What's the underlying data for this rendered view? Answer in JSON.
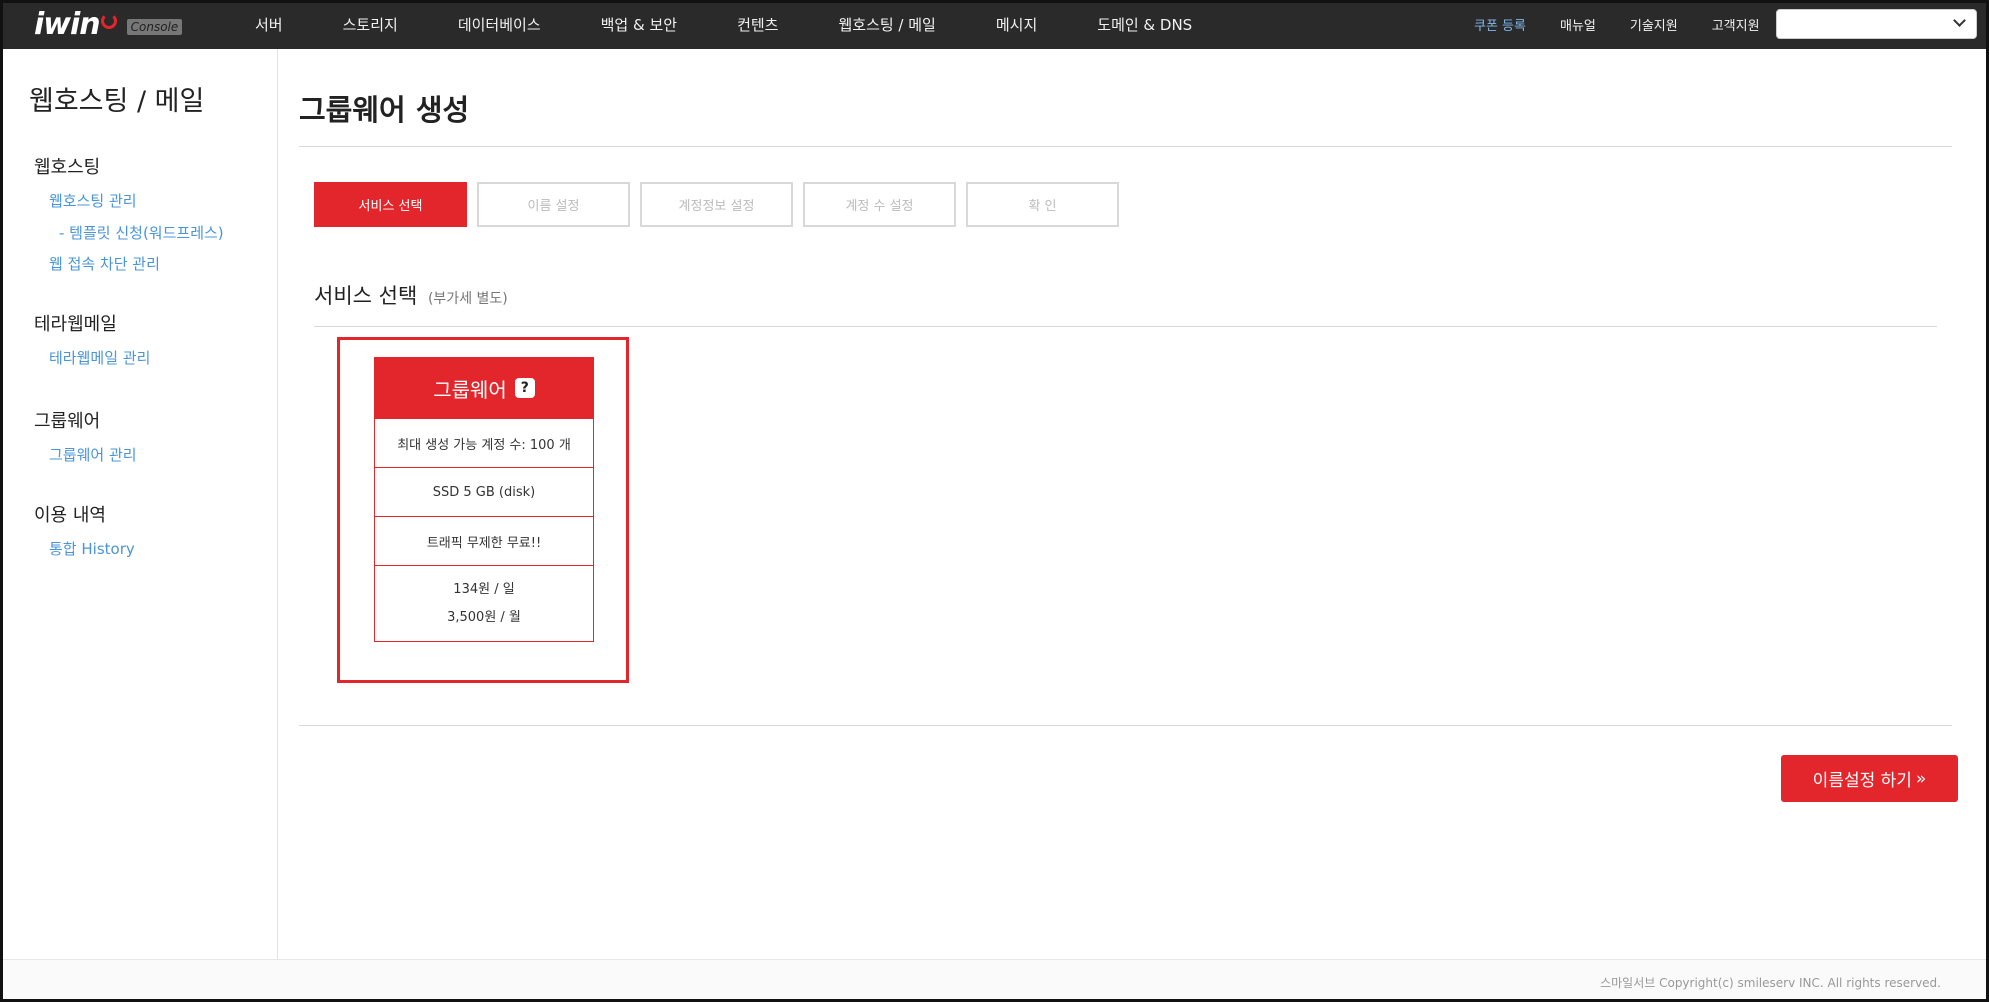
{
  "topbar": {
    "logo_text": "iwin",
    "console_tag": "Console",
    "main_nav": [
      "서버",
      "스토리지",
      "데이터베이스",
      "백업 & 보안",
      "컨텐츠",
      "웹호스팅 / 메일",
      "메시지",
      "도메인 & DNS"
    ],
    "util_nav": {
      "coupon": "쿠폰 등록",
      "manual": "매뉴얼",
      "tech_support": "기술지원",
      "customer_support": "고객지원"
    },
    "account_select_value": ""
  },
  "sidebar": {
    "title": "웹호스팅 / 메일",
    "groups": [
      {
        "head": "웹호스팅",
        "links": [
          "웹호스팅 관리",
          "- 템플릿 신청(워드프레스)",
          "웹 접속 차단 관리"
        ]
      },
      {
        "head": "테라웹메일",
        "links": [
          "테라웹메일 관리"
        ]
      },
      {
        "head": "그룹웨어",
        "links": [
          "그룹웨어 관리"
        ]
      },
      {
        "head": "이용 내역",
        "links": [
          "통합 History"
        ]
      }
    ]
  },
  "main": {
    "page_title": "그룹웨어 생성",
    "steps": [
      "서비스 선택",
      "이름 설정",
      "계정정보 설정",
      "계정 수 설정",
      "확  인"
    ],
    "active_step": 0,
    "section_title": "서비스 선택",
    "section_note": "(부가세 별도)",
    "card": {
      "title": "그룹웨어",
      "help_icon": "?",
      "rows": [
        "최대 생성 가능 계정 수: 100 개",
        "SSD 5 GB (disk)",
        "트래픽 무제한 무료!!"
      ],
      "price_day": "134원 / 일",
      "price_month": "3,500원 / 월"
    },
    "next_button": "이름설정 하기",
    "next_arrows": "»"
  },
  "footer": {
    "copyright": "스마일서브 Copyright(c) smileserv INC. All rights reserved."
  },
  "colors": {
    "accent": "#e3262b",
    "topbar_bg": "#2a2a2a",
    "link_blue": "#4a95d8",
    "coupon_blue": "#7fb6ea"
  }
}
